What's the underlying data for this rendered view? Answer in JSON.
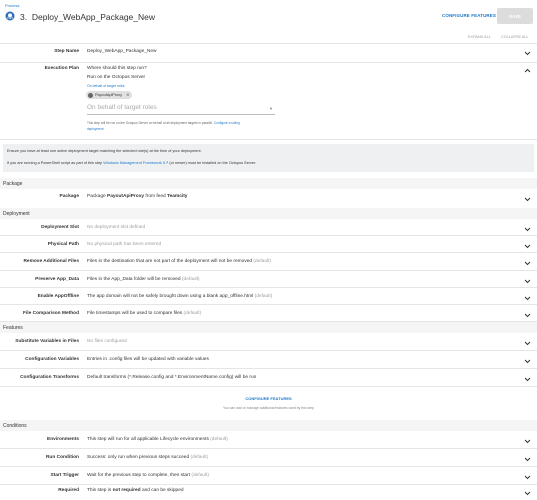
{
  "breadcrumb": "Process",
  "header": {
    "step_number": "3.",
    "title": "Deploy_WebApp_Package_New",
    "configure_features": "CONFIGURE FEATURES",
    "save": "SAVE",
    "expand_all": "EXPAND ALL",
    "collapse_all": "COLLAPSE ALL"
  },
  "step_name": {
    "label": "Step Name",
    "value": "Deploy_WebApp_Package_New"
  },
  "execution_plan": {
    "label": "Execution Plan",
    "question": "Where should this step run?",
    "run_on": "Run on the Octopus Server",
    "on_behalf_link": "On behalf of target roles",
    "chip": "PayoutApiProxy",
    "roles_placeholder": "On behalf of target roles",
    "help_text": "This step will be run on the Octopus Server on behalf of all deployment targets in parallel.",
    "help_link_a": "Configure a rolling",
    "help_link_b": "deployment"
  },
  "notice": {
    "line1": "Ensure you have at least one active deployment target matching the selected role(s) at the time of your deployment.",
    "line2_pre": "If you are running a PowerShell script as part of this step",
    "line2_link": "Windows Management Framework 5",
    "line2_post": "(or newer) must be installed on the Octopus Server."
  },
  "package_section": {
    "heading": "Package",
    "label": "Package",
    "value_pre": "Package",
    "package_name": "PayoutApiProxy",
    "value_mid": "from feed",
    "feed_name": "Teamcity"
  },
  "deployment_section": {
    "heading": "Deployment",
    "rows": [
      {
        "label": "Deployment Slot",
        "text": "",
        "muted": "No deployment slot defined"
      },
      {
        "label": "Physical Path",
        "text": "",
        "muted": "No physical path has been entered"
      },
      {
        "label": "Remove Additional Files",
        "text": "Files in the destination that are not part of the deployment will not be removed",
        "muted": "(default)"
      },
      {
        "label": "Preserve App_Data",
        "text": "Files in the App_Data folder will be removed",
        "muted": "(default)"
      },
      {
        "label": "Enable AppOffline",
        "text": "The app domain will not be safely brought down using a blank app_offline.html",
        "muted": "(default)"
      },
      {
        "label": "File Comparison Method",
        "text": "File timestamps will be used to compare files",
        "muted": "(default)"
      }
    ]
  },
  "features_section": {
    "heading": "Features",
    "rows": [
      {
        "label": "Substitute Variables in Files",
        "text": "",
        "muted": "No files configured"
      },
      {
        "label": "Configuration Variables",
        "text": "Entries in .config files will be updated with variable values",
        "muted": ""
      },
      {
        "label": "Configuration Transforms",
        "text": "Default transforms (*.Release.config and *.EnvironmentName.config) will be run",
        "muted": ""
      }
    ],
    "configure_link": "CONFIGURE FEATURES",
    "configure_help": "You can add or manage additional features used by this step"
  },
  "conditions_section": {
    "heading": "Conditions",
    "rows": [
      {
        "label": "Environments",
        "text": "This step will run for all applicable Lifecycle environments",
        "muted": "(default)"
      },
      {
        "label": "Run Condition",
        "text": "Success: only run when previous steps succeed",
        "muted": "(default)"
      },
      {
        "label": "Start Trigger",
        "text": "Wait for the previous step to complete, then start",
        "muted": "(default)"
      }
    ],
    "required": {
      "label": "Required",
      "pre": "This step is",
      "bold": "not required",
      "post": "and can be skipped"
    }
  },
  "colors": {
    "accent": "#1a77ca",
    "section_bg": "#f5f5f5",
    "note_bg": "#eef0f2",
    "save_disabled": "#dcdcdc"
  }
}
